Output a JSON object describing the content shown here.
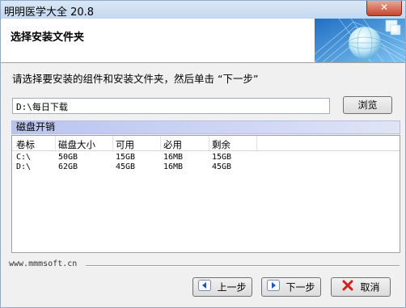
{
  "window": {
    "title": "明明医学大全 20.8",
    "close_glyph": "✕"
  },
  "header": {
    "heading": "选择安装文件夹"
  },
  "instructions": "请选择要安装的组件和安装文件夹，然后单击 “下一步”",
  "install_path": {
    "value": "D:\\每日下载",
    "browse_label": "浏览"
  },
  "disk_section": {
    "title": "磁盘开销",
    "columns": [
      "卷标",
      "磁盘大小",
      "可用",
      "必用",
      "剩余"
    ],
    "rows": [
      [
        "C:\\",
        "50GB",
        "15GB",
        "16MB",
        "15GB"
      ],
      [
        "D:\\",
        "62GB",
        "45GB",
        "16MB",
        "45GB"
      ]
    ]
  },
  "footer": {
    "url": "www.mmmsoft.cn",
    "prev_label": "上一步",
    "next_label": "下一步",
    "cancel_label": "取消"
  }
}
